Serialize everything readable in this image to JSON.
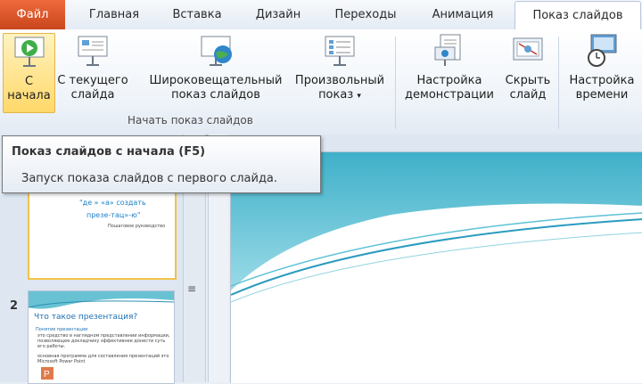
{
  "tabs": {
    "file": "Файл",
    "home": "Главная",
    "insert": "Вставка",
    "design": "Дизайн",
    "transitions": "Переходы",
    "animation": "Анимация",
    "slideshow": "Показ слайдов"
  },
  "ribbon": {
    "from_start": [
      "С",
      "начала"
    ],
    "from_current": [
      "С текущего",
      "слайда"
    ],
    "broadcast": [
      "Широковещательный",
      "показ слайдов"
    ],
    "custom": [
      "Произвольный",
      "показ"
    ],
    "custom_arrow": "▾",
    "group_label": "Начать показ слайдов",
    "setup": [
      "Настройка",
      "демонстрации"
    ],
    "hide": [
      "Скрыть",
      "слайд"
    ],
    "timings": [
      "Настройка",
      "времени"
    ]
  },
  "tooltip": {
    "title": "Показ слайдов с начала (F5)",
    "description": "Запуск показа слайдов с первого слайда."
  },
  "thumbnails": {
    "slide1_title_line1": "\"де » «а» создать",
    "slide1_title_line2": "презе-тац»-ю\"",
    "slide1_subtitle": "Пошаговое руководство",
    "slide2_number": "2",
    "slide2_title": "Что такое презентация?",
    "slide2_heading": "Понятие презентации",
    "slide2_bullet1": "это средство в наглядном представлении информации,",
    "slide2_bullet1b": "позволяющее докладчику эффективнее донести суть",
    "slide2_bullet1c": "его работы.",
    "slide2_bullet2": "основная программа для составления презентаций это",
    "slide2_bullet2b": "Microsoft Power Point"
  },
  "splitter_glyph": "≡",
  "colors": {
    "accent": "#f2c34b",
    "file_tab": "#d35428",
    "slide_teal": "#4fb8cc"
  }
}
